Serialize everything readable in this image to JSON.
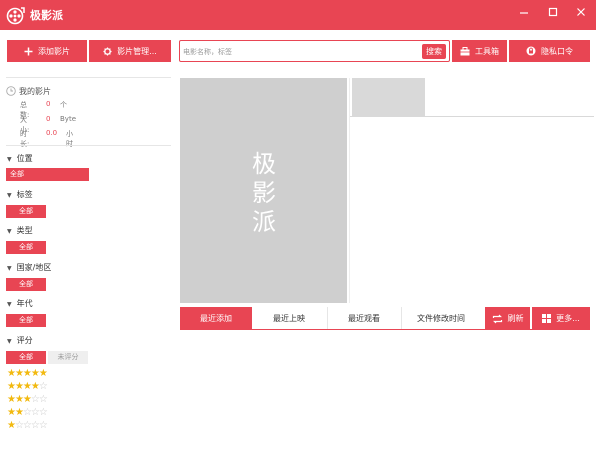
{
  "app": {
    "title": "极影派"
  },
  "window": {
    "minimize_icon": "minimize-icon",
    "maximize_icon": "maximize-icon",
    "close_icon": "close-icon"
  },
  "toolbar": {
    "add_movie": "添加影片",
    "movie_manage": "影片管理...",
    "search_placeholder": "电影名称，标签",
    "search_button": "搜索",
    "toolbox": "工具箱",
    "privacy_password": "隐私口令"
  },
  "library": {
    "title": "我的影片",
    "stats": [
      {
        "label": "总数:",
        "value": "0",
        "unit": "个"
      },
      {
        "label": "大小:",
        "value": "0",
        "unit": "Byte"
      },
      {
        "label": "时长:",
        "value": "0.0",
        "unit": "小时"
      }
    ]
  },
  "filters": {
    "position": {
      "title": "位置",
      "option": "全部"
    },
    "tags": {
      "title": "标签",
      "option": "全部"
    },
    "type": {
      "title": "类型",
      "option": "全部"
    },
    "region": {
      "title": "国家/地区",
      "option": "全部"
    },
    "year": {
      "title": "年代",
      "option": "全部"
    },
    "rating": {
      "title": "评分",
      "options": [
        "全部",
        "未评分"
      ],
      "star_levels": [
        5,
        4,
        3,
        2,
        1
      ]
    }
  },
  "poster": {
    "text": "极影派"
  },
  "sort_tabs": [
    "最近添加",
    "最近上映",
    "最近观看",
    "文件修改时间"
  ],
  "sort_active_index": 0,
  "actions": {
    "refresh": "刷新",
    "more": "更多..."
  },
  "colors": {
    "accent": "#e84553",
    "star": "#f2b90f",
    "poster_bg": "#cfcfcf"
  }
}
